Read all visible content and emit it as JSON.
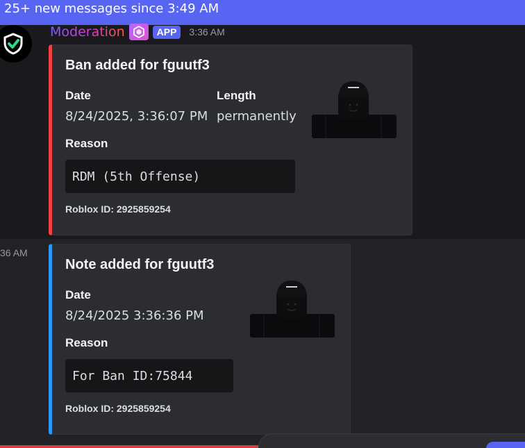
{
  "banner": {
    "text": "25+ new messages since 3:49 AM"
  },
  "message1": {
    "username": "Moderation",
    "app_tag": "APP",
    "timestamp": "3:36 AM",
    "embed": {
      "accent_color": "#f23f42",
      "title": "Ban added for fguutf3",
      "fields": {
        "date_name": "Date",
        "date_value": "8/24/2025, 3:36:07 PM",
        "length_name": "Length",
        "length_value": "permanently",
        "reason_name": "Reason",
        "reason_value": "RDM (5th Offense)"
      },
      "footer": "Roblox ID: 2925859254"
    }
  },
  "message2": {
    "side_time": "36 AM",
    "embed": {
      "accent_color": "#2b96f5",
      "title": "Note added for fguutf3",
      "fields": {
        "date_name": "Date",
        "date_value": "8/24/2025 3:36:36 PM",
        "reason_name": "Reason",
        "reason_value": "For Ban ID:75844"
      },
      "footer": "Roblox ID: 2925859254"
    }
  },
  "icons": {
    "avatar": "shield-check-icon",
    "role": "role-badge-icon",
    "thumbnail": "roblox-avatar-thumbnail"
  }
}
